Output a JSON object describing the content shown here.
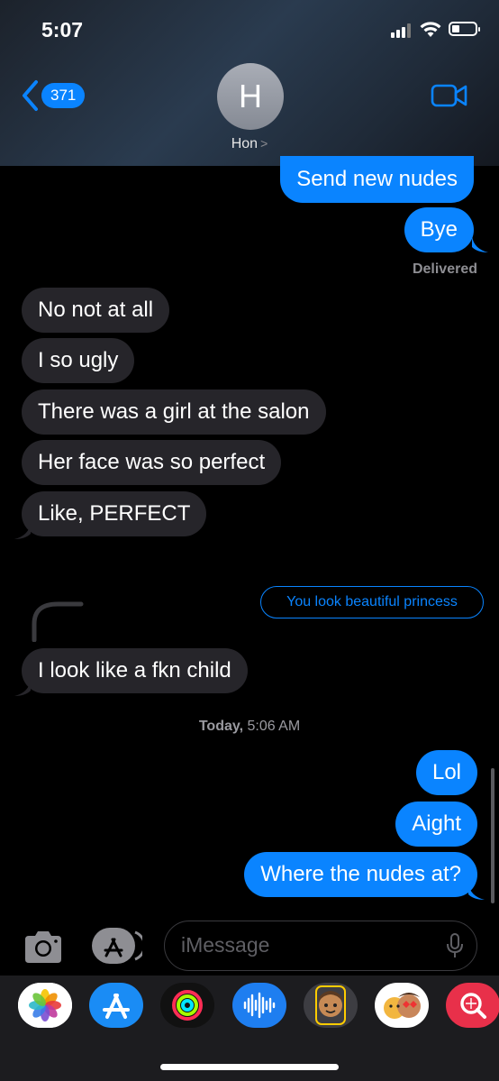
{
  "status_bar": {
    "time": "5:07"
  },
  "header": {
    "back_count": "371",
    "avatar_initial": "H",
    "contact_name": "Hon",
    "contact_arrow": ">"
  },
  "messages": {
    "m1": "Send new nudes",
    "m2": "Bye",
    "delivered": "Delivered",
    "m3": "No not at all",
    "m4": "I so ugly",
    "m5": "There was a girl at the salon",
    "m6": "Her face was so perfect",
    "m7": "Like, PERFECT",
    "reply_ref": "You look beautiful princess",
    "m8": "I look like a fkn child",
    "timestamp_day": "Today,",
    "timestamp_time": "5:06 AM",
    "m9": "Lol",
    "m10": "Aight",
    "m11": "Where the nudes at?"
  },
  "input": {
    "placeholder": "iMessage"
  },
  "colors": {
    "accent": "#0a84ff",
    "incoming": "#26252a",
    "background": "#000000"
  },
  "app_drawer": [
    "photos-icon",
    "app-store-icon",
    "activity-icon",
    "audio-icon",
    "memoji-icon",
    "animoji-icon",
    "search-images-icon"
  ]
}
